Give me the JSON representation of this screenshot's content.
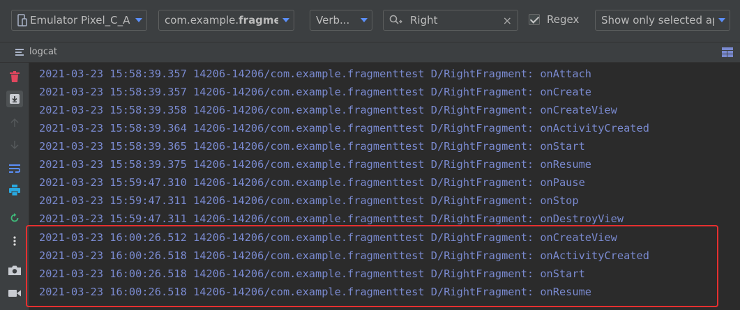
{
  "toolbar": {
    "device": "Emulator Pixel_C_A",
    "package_prefix": "com.example.",
    "package_bold": "fragme",
    "level": "Verb...",
    "search_value": "Right",
    "clear_symbol": "×",
    "regex_label": "Regex",
    "filter": "Show only selected ap"
  },
  "header": {
    "title": "logcat"
  },
  "sidebar": {
    "icons": [
      "trash-icon",
      "scroll-to-end-icon",
      "up-arrow-icon",
      "down-arrow-icon",
      "soft-wrap-icon",
      "print-icon",
      "restart-icon",
      "more-icon",
      "camera-icon",
      "video-icon"
    ]
  },
  "log": {
    "lines": [
      "2021-03-23 15:58:39.357 14206-14206/com.example.fragmenttest D/RightFragment: onAttach",
      "2021-03-23 15:58:39.357 14206-14206/com.example.fragmenttest D/RightFragment: onCreate",
      "2021-03-23 15:58:39.358 14206-14206/com.example.fragmenttest D/RightFragment: onCreateView",
      "2021-03-23 15:58:39.364 14206-14206/com.example.fragmenttest D/RightFragment: onActivityCreated",
      "2021-03-23 15:58:39.365 14206-14206/com.example.fragmenttest D/RightFragment: onStart",
      "2021-03-23 15:58:39.375 14206-14206/com.example.fragmenttest D/RightFragment: onResume",
      "2021-03-23 15:59:47.310 14206-14206/com.example.fragmenttest D/RightFragment: onPause",
      "2021-03-23 15:59:47.311 14206-14206/com.example.fragmenttest D/RightFragment: onStop",
      "2021-03-23 15:59:47.311 14206-14206/com.example.fragmenttest D/RightFragment: onDestroyView",
      "2021-03-23 16:00:26.512 14206-14206/com.example.fragmenttest D/RightFragment: onCreateView",
      "2021-03-23 16:00:26.518 14206-14206/com.example.fragmenttest D/RightFragment: onActivityCreated",
      "2021-03-23 16:00:26.518 14206-14206/com.example.fragmenttest D/RightFragment: onStart",
      "2021-03-23 16:00:26.518 14206-14206/com.example.fragmenttest D/RightFragment: onResume"
    ]
  },
  "colors": {
    "log_text": "#7a8ad0",
    "highlight": "#e53030",
    "accent": "#5b8ff9"
  }
}
